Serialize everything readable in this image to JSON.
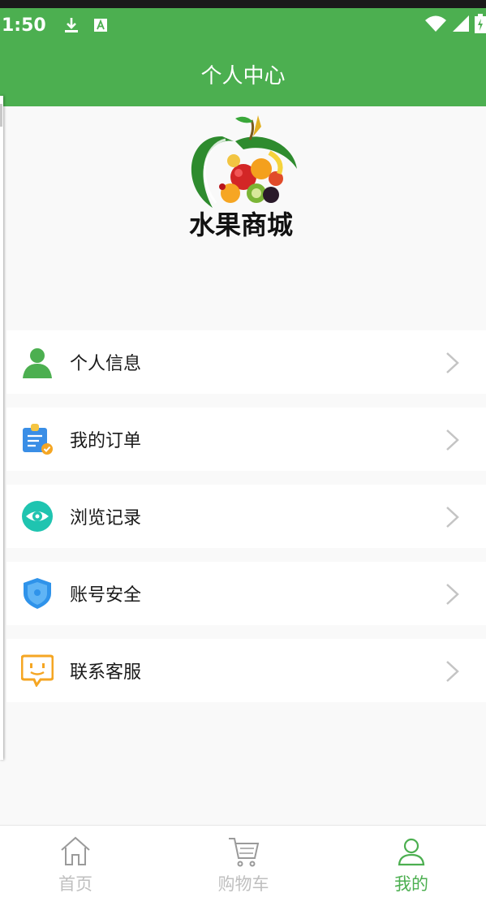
{
  "status_bar": {
    "time": "1:50",
    "icons": [
      "download-icon",
      "a-badge-icon",
      "wifi-icon",
      "signal-icon",
      "battery-charging-icon"
    ]
  },
  "header": {
    "title": "个人中心"
  },
  "logo": {
    "brand_text": "水果商城"
  },
  "menu": {
    "items": [
      {
        "label": "个人信息",
        "icon": "user-icon"
      },
      {
        "label": "我的订单",
        "icon": "order-clipboard-icon"
      },
      {
        "label": "浏览记录",
        "icon": "eye-icon"
      },
      {
        "label": "账号安全",
        "icon": "shield-icon"
      },
      {
        "label": "联系客服",
        "icon": "customer-service-icon"
      }
    ]
  },
  "bottom_nav": {
    "tabs": [
      {
        "label": "首页",
        "icon": "home-icon",
        "active": false
      },
      {
        "label": "购物车",
        "icon": "cart-icon",
        "active": false
      },
      {
        "label": "我的",
        "icon": "profile-icon",
        "active": true
      }
    ]
  },
  "colors": {
    "brand_green": "#4caf50",
    "inactive_tab": "#bfbfbf",
    "chevron": "#c4c4c4"
  }
}
